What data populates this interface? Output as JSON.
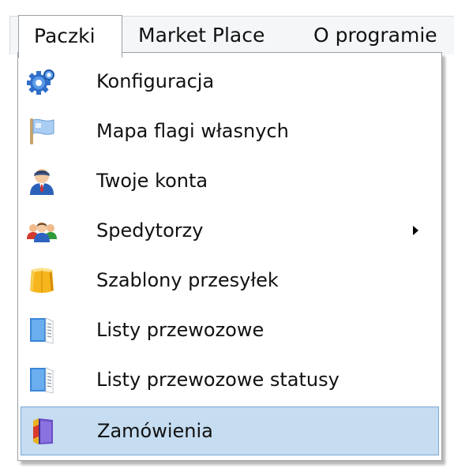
{
  "menubar": {
    "items": [
      {
        "label": "Paczki",
        "active": true
      },
      {
        "label": "Market Place",
        "active": false
      },
      {
        "label": "O programie",
        "active": false
      }
    ]
  },
  "dropdown": {
    "items": [
      {
        "label": "Konfiguracja",
        "icon": "gear-icon",
        "has_submenu": false,
        "highlighted": false
      },
      {
        "label": "Mapa flagi własnych",
        "icon": "flag-icon",
        "has_submenu": false,
        "highlighted": false
      },
      {
        "label": "Twoje konta",
        "icon": "user-icon",
        "has_submenu": false,
        "highlighted": false
      },
      {
        "label": "Spedytorzy",
        "icon": "users-group-icon",
        "has_submenu": true,
        "highlighted": false
      },
      {
        "label": "Szablony przesyłek",
        "icon": "package-icon",
        "has_submenu": false,
        "highlighted": false
      },
      {
        "label": "Listy przewozowe",
        "icon": "document-icon",
        "has_submenu": false,
        "highlighted": false
      },
      {
        "label": "Listy przewozowe statusy",
        "icon": "document-icon",
        "has_submenu": false,
        "highlighted": false
      },
      {
        "label": "Zamówienia",
        "icon": "orders-book-icon",
        "has_submenu": false,
        "highlighted": true
      }
    ]
  },
  "colors": {
    "highlight_bg": "#c5dcf1",
    "highlight_border": "#7aa7d4",
    "menubar_bg": "#f4f6f8"
  }
}
